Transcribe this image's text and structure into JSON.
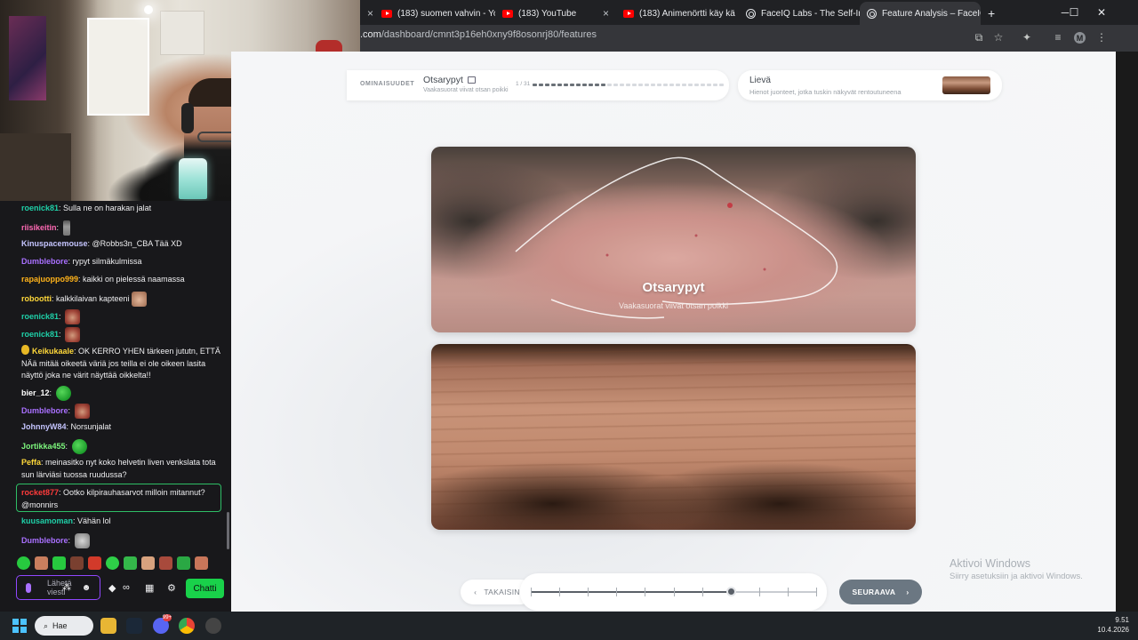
{
  "browser": {
    "tabs": [
      {
        "label": "(183) suomen vahvin - Yo",
        "icon": "youtube-icon",
        "active": false
      },
      {
        "label": "(183) YouTube",
        "icon": "youtube-icon",
        "active": false
      },
      {
        "label": "(183) Animenörtti käy kä",
        "icon": "youtube-icon",
        "active": false
      },
      {
        "label": "FaceIQ Labs - The Self-Im",
        "icon": "faceiq-icon",
        "active": false
      },
      {
        "label": "Feature Analysis – FaceIQ",
        "icon": "faceiq-icon",
        "active": true
      }
    ],
    "new_tab": "+",
    "close_glyph": "×",
    "url_host": ".com",
    "url_path": "/dashboard/cmnt3p16eh0xny9f8osonrj80/features",
    "profile_initial": "M"
  },
  "page": {
    "section_label": "OMINAISUUDET",
    "feature_title": "Otsarypyt",
    "feature_subtitle": "Vaakasuorat viivat otsan poikki",
    "step_counter": "1 / 31",
    "progress": {
      "total_segments": 31,
      "completed_segments": 12
    },
    "severity_title": "Lievä",
    "severity_desc": "Hienot juonteet, jotka tuskin näkyvät rentoutuneena",
    "photo_title": "Otsarypyt",
    "photo_subtitle": "Vaakasuorat viivat otsan poikki",
    "back_label": "TAKAISIN",
    "next_label": "SEURAAVA",
    "slider": {
      "steps": 10,
      "value": 7
    },
    "watermark_title": "Aktivoi Windows",
    "watermark_sub": "Siirry asetuksiin ja aktivoi Windows."
  },
  "chat": {
    "messages": [
      {
        "user": "roenick81",
        "color": "#1fd0a8",
        "text": "Sulla ne on harakan jalat",
        "emotes": []
      },
      {
        "user": "riisikeitin",
        "color": "#ff69b4",
        "text": "",
        "emotes": [
          "bottle"
        ]
      },
      {
        "user": "Kinuspacemouse",
        "color": "#c5c5ff",
        "text": "@Robbs3n_CBA Tää XD",
        "emotes": []
      },
      {
        "user": "Dumblebore",
        "color": "#a970ff",
        "text": "rypyt silmäkulmissa",
        "emotes": []
      },
      {
        "user": "rapajuoppo999",
        "color": "#ffb31a",
        "text": "kaikki on pielessä naamassa",
        "emotes": []
      },
      {
        "user": "robootti",
        "color": "#ffd83a",
        "text": "kalkkilaivan kapteeni",
        "emotes": [
          "face"
        ]
      },
      {
        "user": "roenick81",
        "color": "#1fd0a8",
        "text": "",
        "emotes": [
          "red"
        ]
      },
      {
        "user": "roenick81",
        "color": "#1fd0a8",
        "text": "",
        "emotes": [
          "red"
        ]
      },
      {
        "user": "Keikukaale",
        "color": "#ffd83a",
        "text": "OK KERRO YHEN tärkeen jututn, ETTÄ NÄä mitää oikeetä väriä jos teilla ei ole oikeen lasita näyttö joka ne värit näyttää oikkelta!!",
        "emotes": []
      },
      {
        "user": "bier_12",
        "color": "#ffffff",
        "text": "",
        "emotes": [
          "green"
        ]
      },
      {
        "user": "Dumblebore",
        "color": "#a970ff",
        "text": "",
        "emotes": [
          "red"
        ]
      },
      {
        "user": "JohnnyW84",
        "color": "#c5c5ff",
        "text": "Norsunjalat",
        "emotes": []
      },
      {
        "user": "Jortikka455",
        "color": "#7cf57c",
        "text": "",
        "emotes": [
          "green"
        ]
      },
      {
        "user": "Peffa",
        "color": "#ffd83a",
        "text": "meinasitko nyt koko helvetin liven venkslata tota sun lärviäsi tuossa ruudussa?",
        "emotes": []
      },
      {
        "user": "rocket877",
        "color": "#ff3b3b",
        "text": "Ootko kilpirauhasarvot milloin mitannut? @monnirs",
        "emotes": []
      },
      {
        "user": "kuusamoman",
        "color": "#1fd0a8",
        "text": "Vähän lol",
        "emotes": []
      },
      {
        "user": "Dumblebore",
        "color": "#a970ff",
        "text": "",
        "emotes": [
          "cat"
        ]
      }
    ],
    "input_placeholder": "Lähetä viesti",
    "chat_button": "Chatti"
  },
  "taskbar": {
    "search_label": "Hae",
    "discord_badge": "99+",
    "time": "9.51",
    "date": "10.4.2026"
  }
}
